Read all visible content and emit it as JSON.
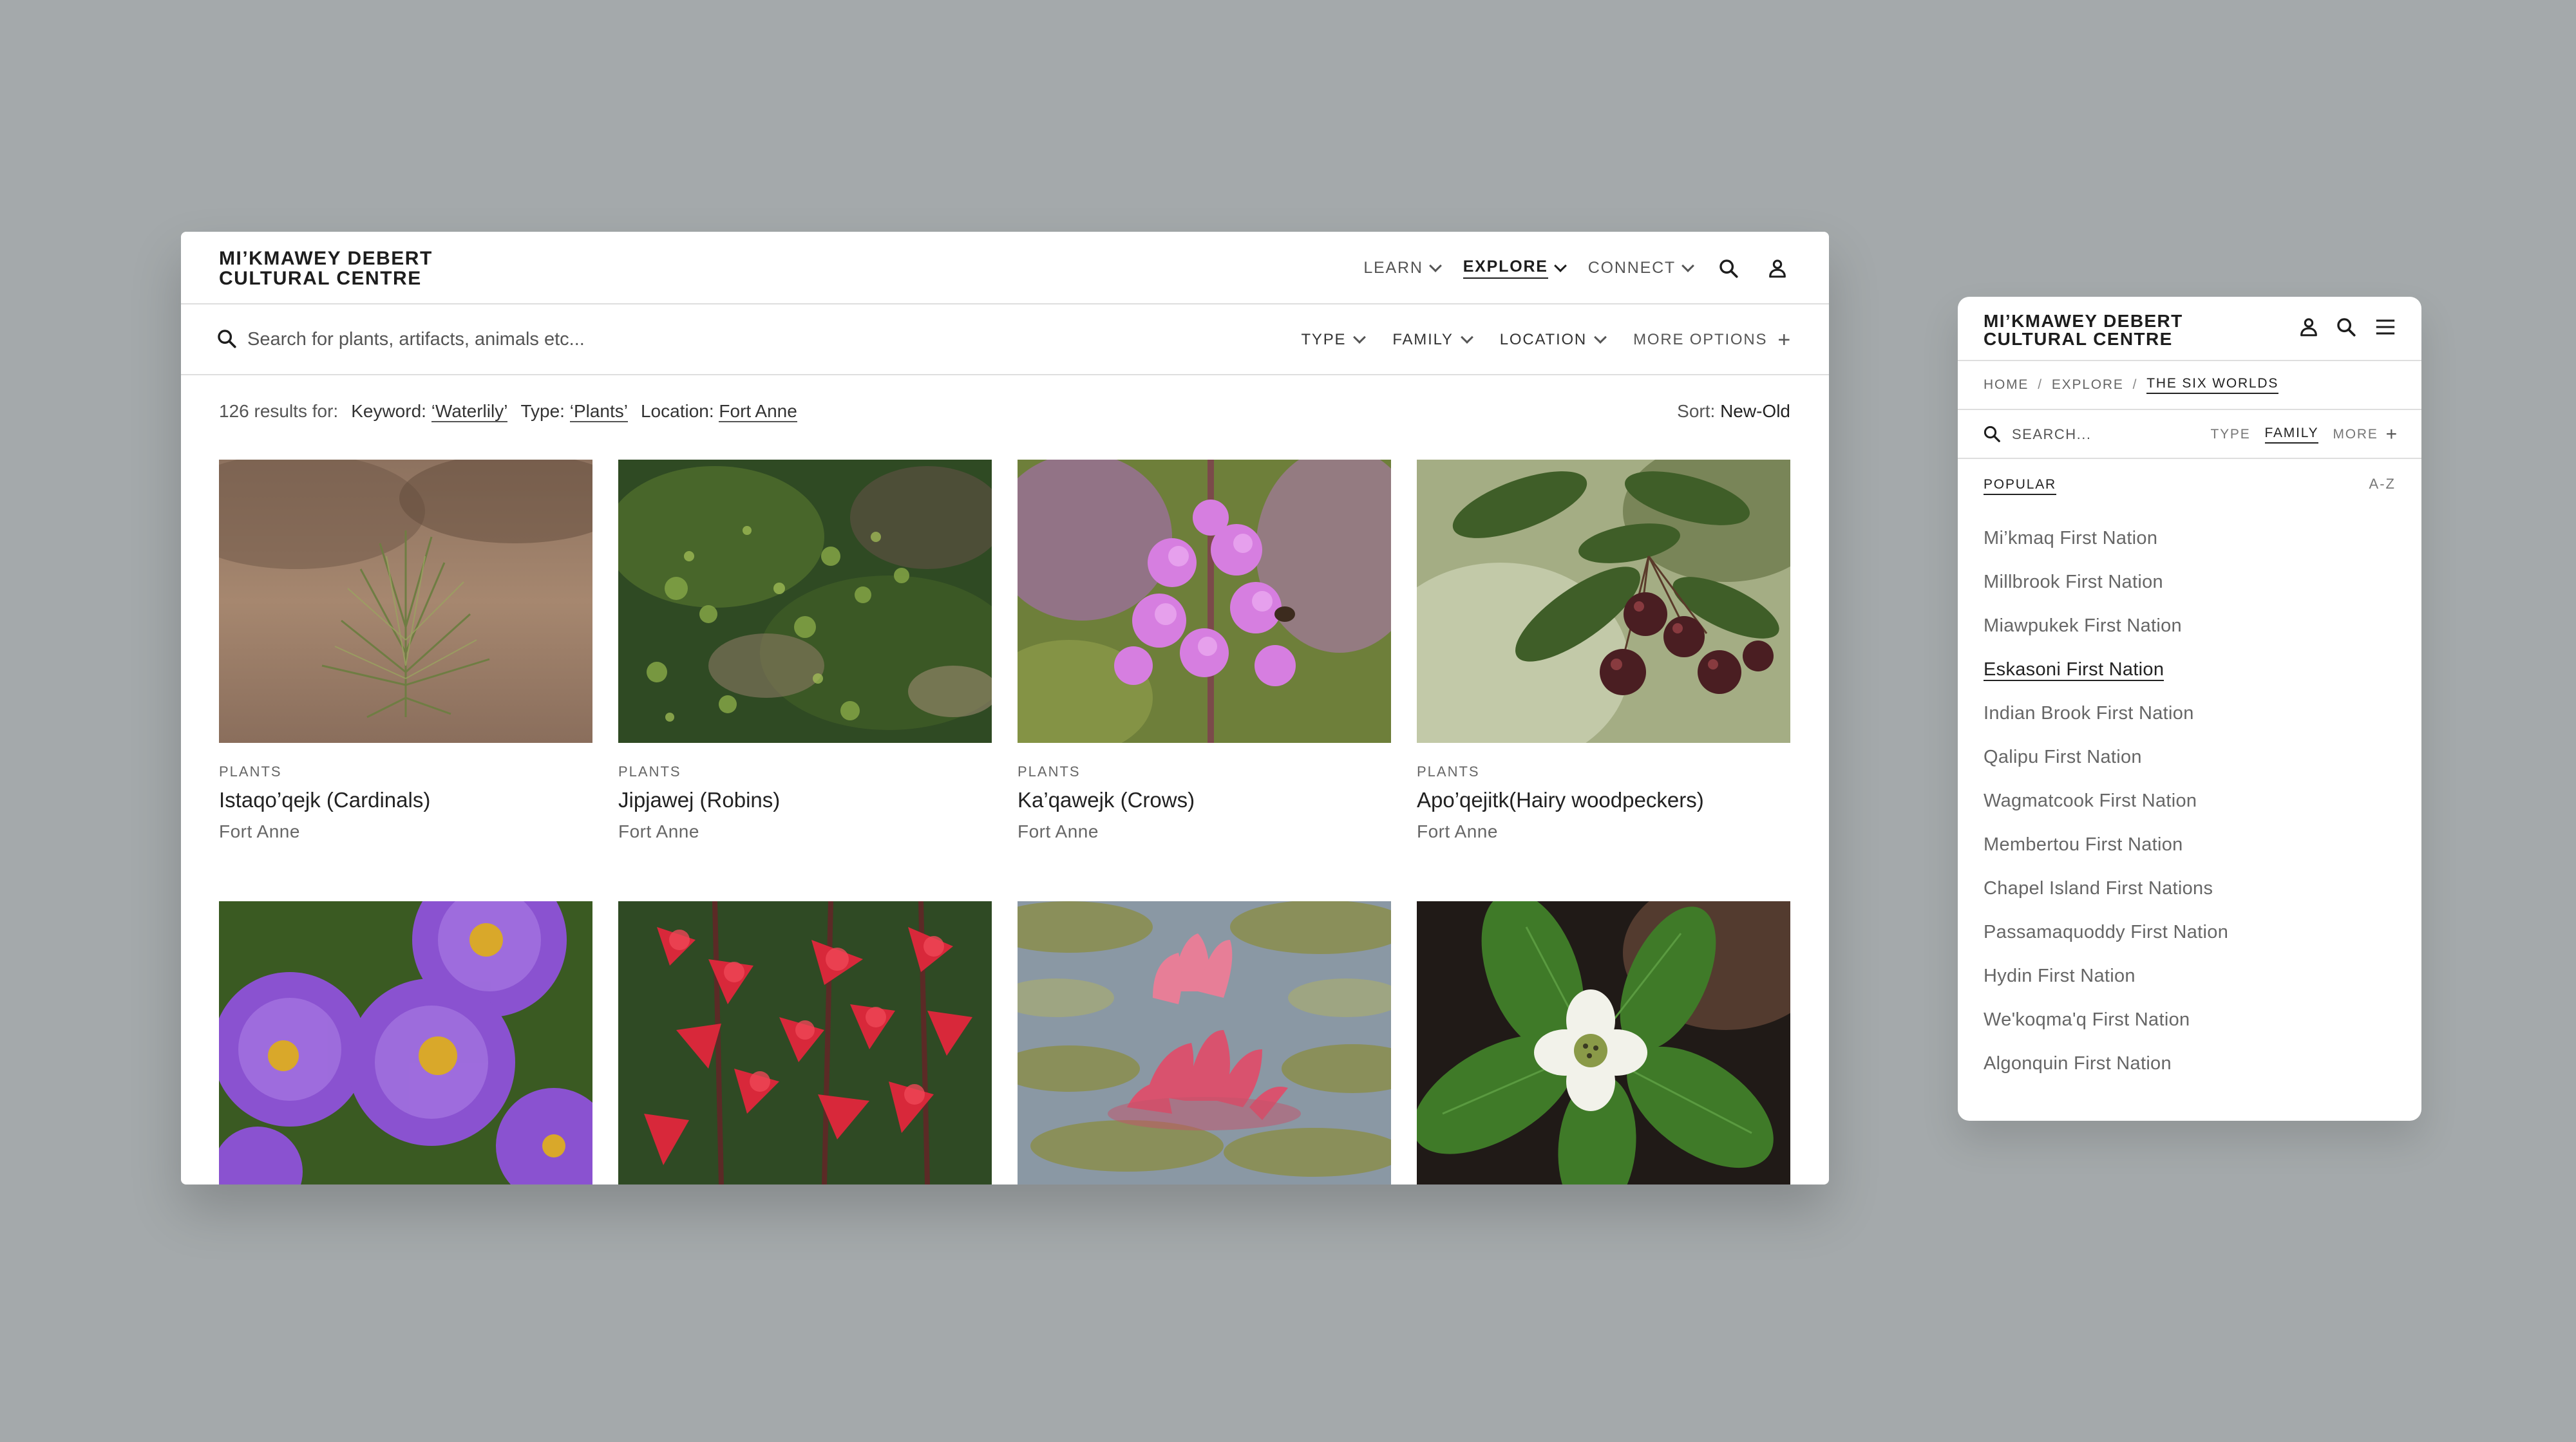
{
  "desktop": {
    "brand": {
      "line1": "MI’KMAWEY DEBERT",
      "line2": "CULTURAL CENTRE"
    },
    "nav": [
      {
        "label": "LEARN",
        "active": false
      },
      {
        "label": "EXPLORE",
        "active": true
      },
      {
        "label": "CONNECT",
        "active": false
      }
    ],
    "search": {
      "placeholder": "Search for plants, artifacts, animals etc..."
    },
    "filters": {
      "type": "TYPE",
      "family": "FAMILY",
      "location": "LOCATION",
      "more": "MORE OPTIONS"
    },
    "results": {
      "count_text": "126 results for:",
      "keyword_label": "Keyword:",
      "keyword_value": "‘Waterlily’",
      "type_label": "Type:",
      "type_value": "‘Plants’",
      "location_label": "Location:",
      "location_value": "Fort Anne",
      "sort_label": "Sort:",
      "sort_value": "New-Old"
    },
    "cards": [
      {
        "category": "PLANTS",
        "title": "Istaqo’qejk (Cardinals)",
        "location": "Fort Anne",
        "image": "pine-seedling"
      },
      {
        "category": "PLANTS",
        "title": "Jipjawej (Robins)",
        "location": "Fort Anne",
        "image": "moss"
      },
      {
        "category": "PLANTS",
        "title": "Ka’qawejk (Crows)",
        "location": "Fort Anne",
        "image": "fireweed"
      },
      {
        "category": "PLANTS",
        "title": "Apo’qejitk(Hairy woodpeckers)",
        "location": "Fort Anne",
        "image": "berries"
      },
      {
        "category": "",
        "title": "",
        "location": "",
        "image": "purple-aster"
      },
      {
        "category": "",
        "title": "",
        "location": "",
        "image": "cardinal-flower"
      },
      {
        "category": "",
        "title": "",
        "location": "",
        "image": "waterlily"
      },
      {
        "category": "",
        "title": "",
        "location": "",
        "image": "bunchberry"
      }
    ]
  },
  "mobile": {
    "brand": {
      "line1": "MI’KMAWEY DEBERT",
      "line2": "CULTURAL CENTRE"
    },
    "breadcrumb": {
      "home": "HOME",
      "explore": "EXPLORE",
      "current": "THE SIX WORLDS",
      "sep": "/"
    },
    "search": {
      "placeholder": "SEARCH..."
    },
    "filters": {
      "type": "TYPE",
      "family": "FAMILY",
      "more": "MORE"
    },
    "sort": {
      "popular": "POPULAR",
      "az": "A-Z"
    },
    "list": [
      "Mi’kmaq First Nation",
      "Millbrook First Nation",
      "Miawpukek First Nation",
      "Eskasoni First Nation",
      "Indian Brook First Nation",
      "Qalipu First Nation",
      "Wagmatcook First Nation",
      "Membertou First Nation",
      "Chapel Island First Nations",
      "Passamaquoddy First Nation",
      "Hydin First Nation",
      "We'koqma'q First Nation",
      "Algonquin First Nation"
    ],
    "selected_index": 3
  }
}
